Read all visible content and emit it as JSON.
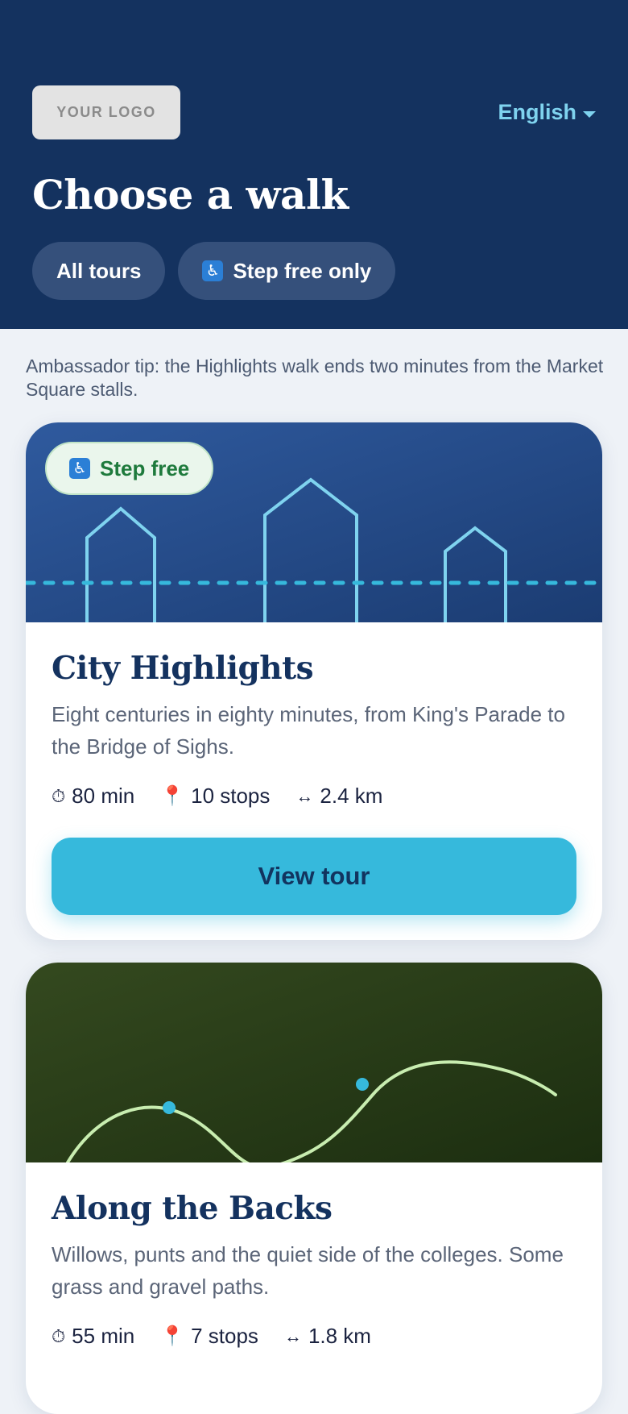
{
  "header": {
    "logo_text": "YOUR LOGO",
    "language": "English",
    "title": "Choose a walk",
    "filters": [
      {
        "label": "All tours"
      },
      {
        "label": "Step free only",
        "icon": "wheelchair-icon"
      }
    ],
    "background": "#14325f"
  },
  "tip": "Ambassador tip: the Highlights walk ends two minutes from the Market Square stalls.",
  "tours": [
    {
      "badge": "Step free",
      "name": "City Highlights",
      "description": "Eight centuries in eighty minutes, from King's Parade to the Bridge of Sighs.",
      "duration": "80 min",
      "stops": "10 stops",
      "distance": "2.4 km",
      "cta": "View tour",
      "banner_color": "#2a4d8f"
    },
    {
      "name": "Along the Backs",
      "description": "Willows, punts and the quiet side of the colleges. Some grass and gravel paths.",
      "duration": "55 min",
      "stops": "7 stops",
      "distance": "1.8 km",
      "banner_color": "#2c4418"
    }
  ],
  "icons": {
    "duration": "stopwatch-icon",
    "stops": "pin-icon",
    "distance": "arrows-horizontal-icon",
    "accessibility": "wheelchair-icon"
  },
  "colors": {
    "accent": "#36b9dc",
    "link": "#7fd3ef",
    "step_free_green": "#1e7a3c"
  }
}
